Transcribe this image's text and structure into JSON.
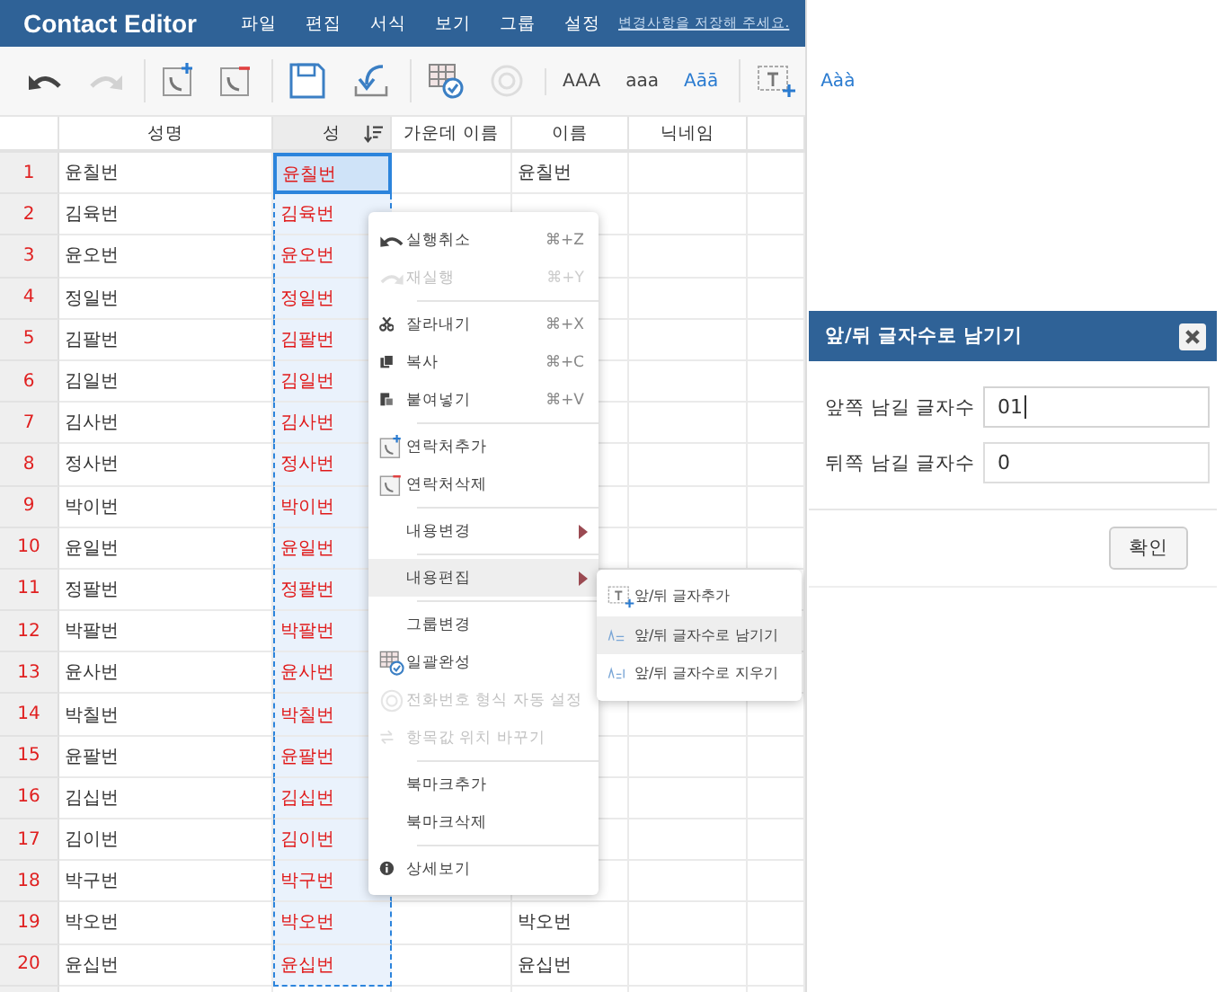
{
  "window": {
    "title": "Contact Editor"
  },
  "menu_bar": [
    {
      "label": "파일"
    },
    {
      "label": "편집"
    },
    {
      "label": "서식"
    },
    {
      "label": "보기"
    },
    {
      "label": "그룹"
    },
    {
      "label": "설정"
    }
  ],
  "save_notice": "변경사항을 저장해 주세요.",
  "toolbar": [
    {
      "kind": "undo",
      "disabled": false,
      "group_start": false
    },
    {
      "kind": "redo",
      "disabled": true,
      "group_start": false
    },
    {
      "kind": "add-contact",
      "disabled": false,
      "group_start": true
    },
    {
      "kind": "remove-contact",
      "disabled": false,
      "group_start": false
    },
    {
      "kind": "save",
      "disabled": false,
      "group_start": true
    },
    {
      "kind": "import",
      "disabled": false,
      "group_start": false
    },
    {
      "kind": "grid-check",
      "disabled": false,
      "group_start": true
    },
    {
      "kind": "phone",
      "disabled": true,
      "group_start": false
    },
    {
      "kind": "text",
      "label": "AAA",
      "disabled": false,
      "group_start": true
    },
    {
      "kind": "text",
      "label": "aaa",
      "disabled": false,
      "group_start": false
    },
    {
      "kind": "text",
      "label": "Aāā",
      "disabled": false,
      "group_start": false
    },
    {
      "kind": "insert-text",
      "disabled": false,
      "group_start": true
    },
    {
      "kind": "text",
      "label": "Aàà",
      "disabled": false,
      "group_start": false
    }
  ],
  "grid": {
    "columns": [
      {
        "label": "성명",
        "selected": false
      },
      {
        "label": "성",
        "selected": true
      },
      {
        "label": "가운데 이름",
        "selected": false
      },
      {
        "label": "이름",
        "selected": false
      },
      {
        "label": "닉네임",
        "selected": false
      }
    ],
    "rows": [
      {
        "number": "1",
        "full_name": "윤칠번",
        "last_name": "윤칠번",
        "first_name": "윤칠번",
        "selected": true
      },
      {
        "number": "2",
        "full_name": "김육번",
        "last_name": "김육번",
        "selected": false
      },
      {
        "number": "3",
        "full_name": "윤오번",
        "last_name": "윤오번",
        "selected": false
      },
      {
        "number": "4",
        "full_name": "정일번",
        "last_name": "정일번",
        "selected": false
      },
      {
        "number": "5",
        "full_name": "김팔번",
        "last_name": "김팔번",
        "selected": false
      },
      {
        "number": "6",
        "full_name": "김일번",
        "last_name": "김일번",
        "selected": false
      },
      {
        "number": "7",
        "full_name": "김사번",
        "last_name": "김사번",
        "selected": false
      },
      {
        "number": "8",
        "full_name": "정사번",
        "last_name": "정사번",
        "selected": false
      },
      {
        "number": "9",
        "full_name": "박이번",
        "last_name": "박이번",
        "selected": false
      },
      {
        "number": "10",
        "full_name": "윤일번",
        "last_name": "윤일번",
        "selected": false
      },
      {
        "number": "11",
        "full_name": "정팔번",
        "last_name": "정팔번",
        "selected": false
      },
      {
        "number": "12",
        "full_name": "박팔번",
        "last_name": "박팔번",
        "selected": false
      },
      {
        "number": "13",
        "full_name": "윤사번",
        "last_name": "윤사번",
        "selected": false
      },
      {
        "number": "14",
        "full_name": "박칠번",
        "last_name": "박칠번",
        "selected": false
      },
      {
        "number": "15",
        "full_name": "윤팔번",
        "last_name": "윤팔번",
        "selected": false
      },
      {
        "number": "16",
        "full_name": "김십번",
        "last_name": "김십번",
        "selected": false
      },
      {
        "number": "17",
        "full_name": "김이번",
        "last_name": "김이번",
        "selected": false
      },
      {
        "number": "18",
        "full_name": "박구번",
        "last_name": "박구번",
        "selected": false
      },
      {
        "number": "19",
        "full_name": "박오번",
        "last_name": "박오번",
        "first_name": "박오번",
        "selected": false
      },
      {
        "number": "20",
        "full_name": "윤십번",
        "last_name": "윤십번",
        "first_name": "윤십번",
        "selected": false
      }
    ]
  },
  "context_menu": {
    "items": [
      {
        "kind": "undo",
        "label": "실행취소",
        "shortcut": "⌘+Z",
        "disabled": false,
        "submenu": false,
        "selected": false
      },
      {
        "kind": "redo",
        "label": "재실행",
        "shortcut": "⌘+Y",
        "disabled": true,
        "submenu": false,
        "selected": false
      },
      {
        "kind": "separator"
      },
      {
        "kind": "cut",
        "label": "잘라내기",
        "shortcut": "⌘+X",
        "disabled": false,
        "submenu": false,
        "selected": false
      },
      {
        "kind": "copy",
        "label": "복사",
        "shortcut": "⌘+C",
        "disabled": false,
        "submenu": false,
        "selected": false
      },
      {
        "kind": "paste",
        "label": "붙여넣기",
        "shortcut": "⌘+V",
        "disabled": false,
        "submenu": false,
        "selected": false
      },
      {
        "kind": "separator"
      },
      {
        "kind": "add-contact",
        "label": "연락처추가",
        "disabled": false,
        "submenu": false,
        "selected": false
      },
      {
        "kind": "remove-contact",
        "label": "연락처삭제",
        "disabled": false,
        "submenu": false,
        "selected": false
      },
      {
        "kind": "separator"
      },
      {
        "kind": "plain",
        "label": "내용변경",
        "disabled": false,
        "submenu": true,
        "selected": false
      },
      {
        "kind": "separator"
      },
      {
        "kind": "plain",
        "label": "내용편집",
        "disabled": false,
        "submenu": true,
        "selected": true
      },
      {
        "kind": "separator"
      },
      {
        "kind": "plain",
        "label": "그룹변경",
        "disabled": false,
        "submenu": false,
        "selected": false
      },
      {
        "kind": "grid-check",
        "label": "일괄완성",
        "disabled": false,
        "submenu": false,
        "selected": false
      },
      {
        "kind": "phone",
        "label": "전화번호 형식 자동 설정",
        "disabled": true,
        "submenu": false,
        "selected": false
      },
      {
        "kind": "swap",
        "label": "항목값 위치 바꾸기",
        "disabled": true,
        "submenu": false,
        "selected": false
      },
      {
        "kind": "separator"
      },
      {
        "kind": "plain",
        "label": "북마크추가",
        "disabled": false,
        "submenu": false,
        "selected": false
      },
      {
        "kind": "plain",
        "label": "북마크삭제",
        "disabled": false,
        "submenu": false,
        "selected": false
      },
      {
        "kind": "separator"
      },
      {
        "kind": "info",
        "label": "상세보기",
        "disabled": false,
        "submenu": false,
        "selected": false
      }
    ]
  },
  "submenu": {
    "items": [
      {
        "kind": "insert-text",
        "label": "앞/뒤 글자추가",
        "selected": false
      },
      {
        "kind": "keep-text",
        "label": "앞/뒤 글자수로 남기기",
        "selected": true
      },
      {
        "kind": "erase-text",
        "label": "앞/뒤 글자수로 지우기",
        "selected": false
      }
    ]
  },
  "dialog": {
    "title": "앞/뒤 글자수로 남기기",
    "fields": [
      {
        "label": "앞쪽 남길 글자수",
        "value": "01",
        "focused": true
      },
      {
        "label": "뒤쪽 남길 글자수",
        "value": "0",
        "focused": false
      }
    ],
    "button": "확인"
  }
}
